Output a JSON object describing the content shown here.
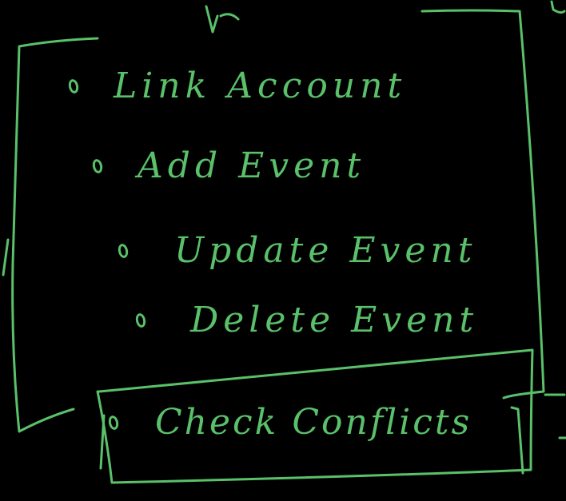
{
  "diagram": {
    "ink_color": "#5ac06a",
    "background": "#000000",
    "outer_list": {
      "items": [
        {
          "label": "Link Account"
        },
        {
          "label": "Add Event"
        },
        {
          "label": "Update Event"
        },
        {
          "label": "Delete Event"
        }
      ]
    },
    "highlighted_item": {
      "label": "Check Conflicts"
    }
  }
}
